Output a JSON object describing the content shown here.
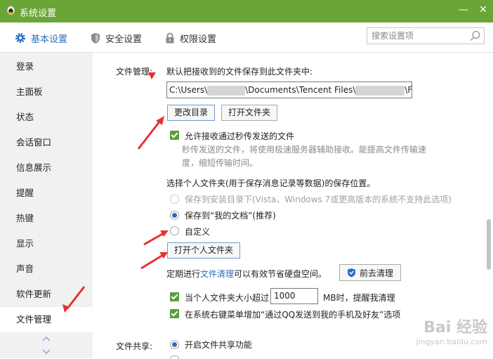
{
  "window": {
    "title": "系统设置"
  },
  "tabs": [
    {
      "label": "基本设置",
      "icon": "gear-icon"
    },
    {
      "label": "安全设置",
      "icon": "shield-icon"
    },
    {
      "label": "权限设置",
      "icon": "lock-icon"
    }
  ],
  "search": {
    "placeholder": "搜索设置项"
  },
  "sidebar": {
    "items": [
      "登录",
      "主面板",
      "状态",
      "会话窗口",
      "信息展示",
      "提醒",
      "热键",
      "显示",
      "声音",
      "软件更新",
      "文件管理"
    ],
    "active": "文件管理"
  },
  "file_mgmt": {
    "section_label": "文件管理:",
    "save_desc": "默认把接收到的文件保存到此文件夹中:",
    "path": {
      "part1": "C:\\Users\\",
      "part2": "\\Documents\\Tencent Files\\",
      "part3": "\\File"
    },
    "change_dir_btn": "更改目录",
    "open_folder_btn": "打开文件夹",
    "allow_transfer": "允许接收通过秒传发送的文件",
    "transfer_hint": "秒传发送的文件，将使用极速服务器辅助接收。能提高文件传输速度，缩短传输时间。",
    "personal_folder_desc": "选择个人文件夹(用于保存消息记录等数据)的保存位置。",
    "opt_install_dir": "保存到安装目录下(Vista、Windows 7或更高版本的系统不支持此选项)",
    "opt_my_docs": "保存到“我的文档”(推荐)",
    "opt_custom": "自定义",
    "open_personal_btn": "打开个人文件夹",
    "cleanup_prefix": "定期进行",
    "cleanup_link": "文件清理",
    "cleanup_suffix": "可以有效节省硬盘空间。",
    "cleanup_btn": "前去清理",
    "size_limit_prefix": "当个人文件夹大小超过",
    "size_limit_value": "1000",
    "size_limit_suffix": "MB时，提醒我清理",
    "context_menu_opt": "在系统右键菜单增加“通过QQ发送到我的手机及好友”选项"
  },
  "file_share": {
    "section_label": "文件共享:",
    "enable_share": "开启文件共享功能"
  },
  "watermark": {
    "text": "Bai 经验",
    "sub": "jingyan.baidu.com"
  },
  "colors": {
    "titlebar": "#6aa636",
    "accent": "#2c6fc2",
    "checkbox": "#5a9e38",
    "arrow": "#e8312f"
  }
}
